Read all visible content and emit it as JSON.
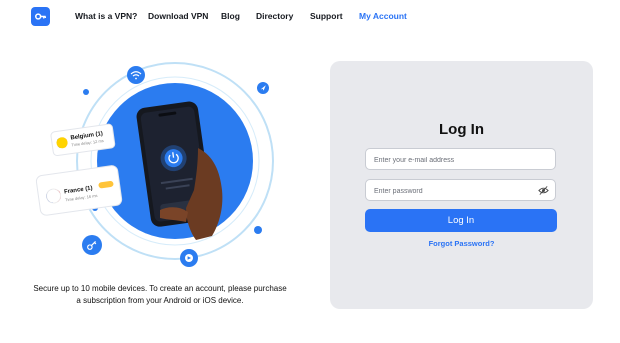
{
  "nav": {
    "logo_icon": "key-icon",
    "items": [
      {
        "label": "What is a VPN?",
        "active": false
      },
      {
        "label": "Download VPN",
        "active": false
      },
      {
        "label": "Blog",
        "active": false
      },
      {
        "label": "Directory",
        "active": false
      },
      {
        "label": "Support",
        "active": false
      },
      {
        "label": "My Account",
        "active": true
      }
    ]
  },
  "hero": {
    "tiles": [
      {
        "flag": "belgium-flag",
        "country": "Belgium (1)",
        "delay": "Time delay: 12 ms"
      },
      {
        "flag": "france-flag",
        "country": "France (1)",
        "delay": "Time delay: 16 ms"
      }
    ],
    "badges": [
      "wifi-icon",
      "location-arrow-icon",
      "key-icon",
      "play-icon"
    ],
    "phone_icon": "power-icon",
    "caption_line1": "Secure up to 10 mobile devices. To create an account, please purchase",
    "caption_line2": "a subscription from your Android or iOS device."
  },
  "login": {
    "title": "Log In",
    "email_placeholder": "Enter your e-mail address",
    "password_placeholder": "Enter password",
    "password_toggle_icon": "eye-slash-icon",
    "submit_label": "Log In",
    "forgot_label": "Forgot Password?"
  },
  "colors": {
    "accent": "#2a73f5",
    "panel_bg": "#e8e9ed",
    "ring": "#bfe0f6"
  }
}
